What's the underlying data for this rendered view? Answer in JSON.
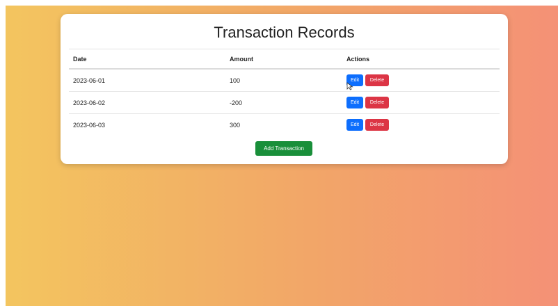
{
  "title": "Transaction Records",
  "table": {
    "headers": {
      "date": "Date",
      "amount": "Amount",
      "actions": "Actions"
    },
    "rows": [
      {
        "date": "2023-06-01",
        "amount": "100"
      },
      {
        "date": "2023-06-02",
        "amount": "-200"
      },
      {
        "date": "2023-06-03",
        "amount": "300"
      }
    ],
    "edit_label": "Edit",
    "delete_label": "Delete"
  },
  "add_button_label": "Add Transaction",
  "colors": {
    "edit": "#0d6efd",
    "delete": "#dc3545",
    "add": "#198f3a",
    "gradient_start": "#f3c55f",
    "gradient_end": "#f49176"
  },
  "cursor": "pointer-cursor-icon"
}
